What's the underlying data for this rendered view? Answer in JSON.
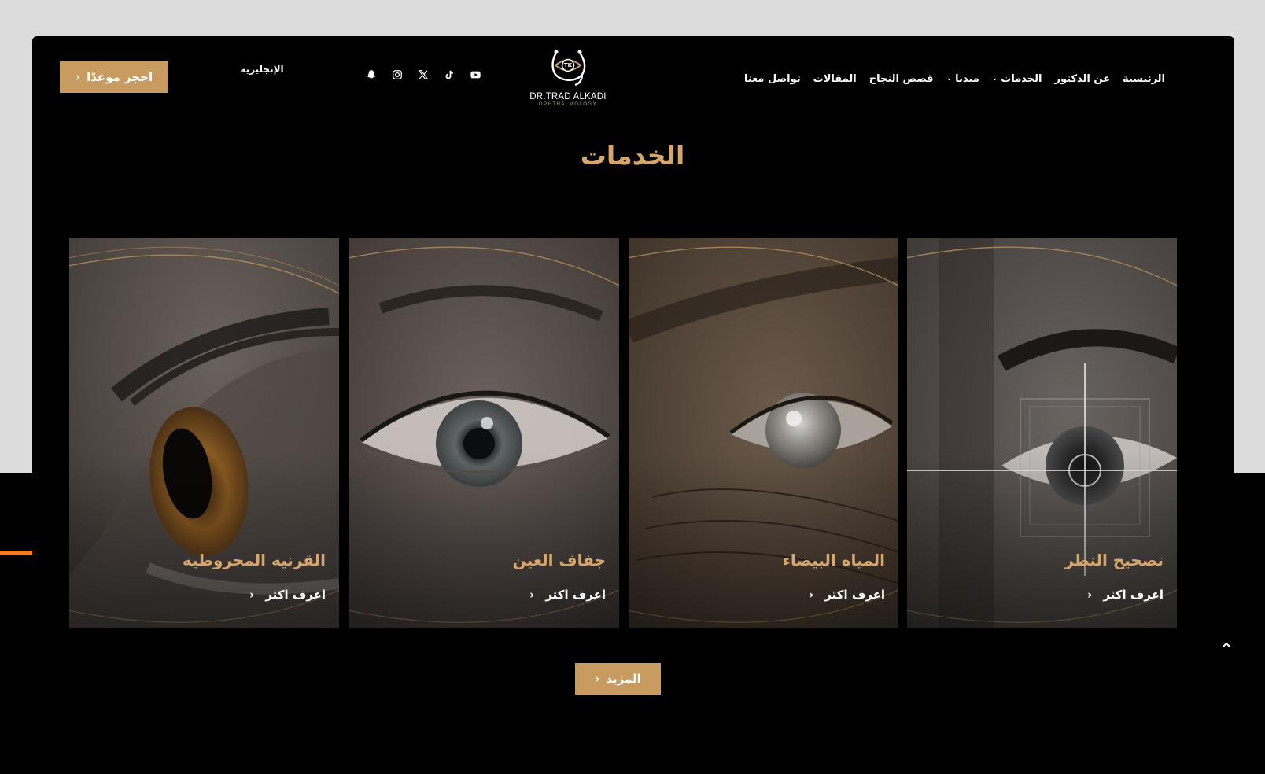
{
  "header": {
    "cta_label": "احجز موعدًا",
    "cta_chevron": "‹",
    "language_label": "الإنجليزية",
    "logo": {
      "name": "DR.TRAD ALKADI",
      "tagline": "OPHTHALMOLOGY",
      "monogram": "TK"
    },
    "social_icons": [
      "snapchat-icon",
      "instagram-icon",
      "x-icon",
      "tiktok-icon",
      "youtube-icon"
    ],
    "nav": [
      {
        "label": "الرئيسية"
      },
      {
        "label": "عن الدكتور"
      },
      {
        "label": "الخدمات",
        "caret": "⌄"
      },
      {
        "label": "ميديا",
        "caret": "⌄"
      },
      {
        "label": "قصص النجاح"
      },
      {
        "label": "المقالات"
      },
      {
        "label": "تواصل معنا"
      }
    ]
  },
  "section": {
    "title": "الخدمات"
  },
  "cards": [
    {
      "title": "تصحيح النظر",
      "more": "اعرف اكثر",
      "chevron": "‹"
    },
    {
      "title": "المياه البيضاء",
      "more": "اعرف اكثر",
      "chevron": "‹"
    },
    {
      "title": "جفاف العين",
      "more": "اعرف اكثر",
      "chevron": "‹"
    },
    {
      "title": "القرنيه المخروطيه",
      "more": "اعرف اكثر",
      "chevron": "‹"
    }
  ],
  "more_button": {
    "label": "المزيد",
    "chevron": "‹"
  },
  "colors": {
    "gold": "#c89c60",
    "title_gold": "#d6a66a",
    "accent_orange": "#f47b20",
    "background": "#000000"
  }
}
